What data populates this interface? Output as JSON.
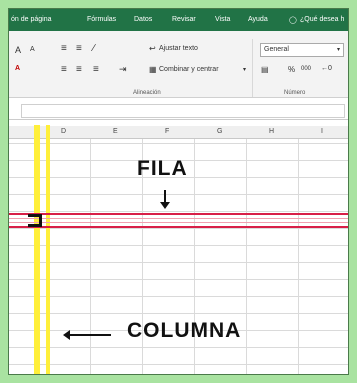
{
  "menu": {
    "items": [
      "ón de página",
      "Fórmulas",
      "Datos",
      "Revisar",
      "Vista",
      "Ayuda"
    ],
    "search_icon": "lightbulb-icon",
    "search_text": "¿Qué desea h"
  },
  "ribbon": {
    "font_size_up": "A",
    "font_size_down": "A",
    "wrap_text": "Ajustar texto",
    "merge_center": "Combinar y centrar",
    "number_format": "General",
    "percent": "%",
    "thousands": "000",
    "group_alignment": "Alineación",
    "group_number": "Número"
  },
  "columns": [
    "D",
    "E",
    "F",
    "G",
    "H",
    "I"
  ],
  "annotations": {
    "row_label": "FILA",
    "column_label": "COLUMNA"
  },
  "colors": {
    "excel_green": "#217346",
    "row_highlight": "#d81e47",
    "column_highlight": "#ffef3a",
    "background": "#a9e3a1"
  }
}
